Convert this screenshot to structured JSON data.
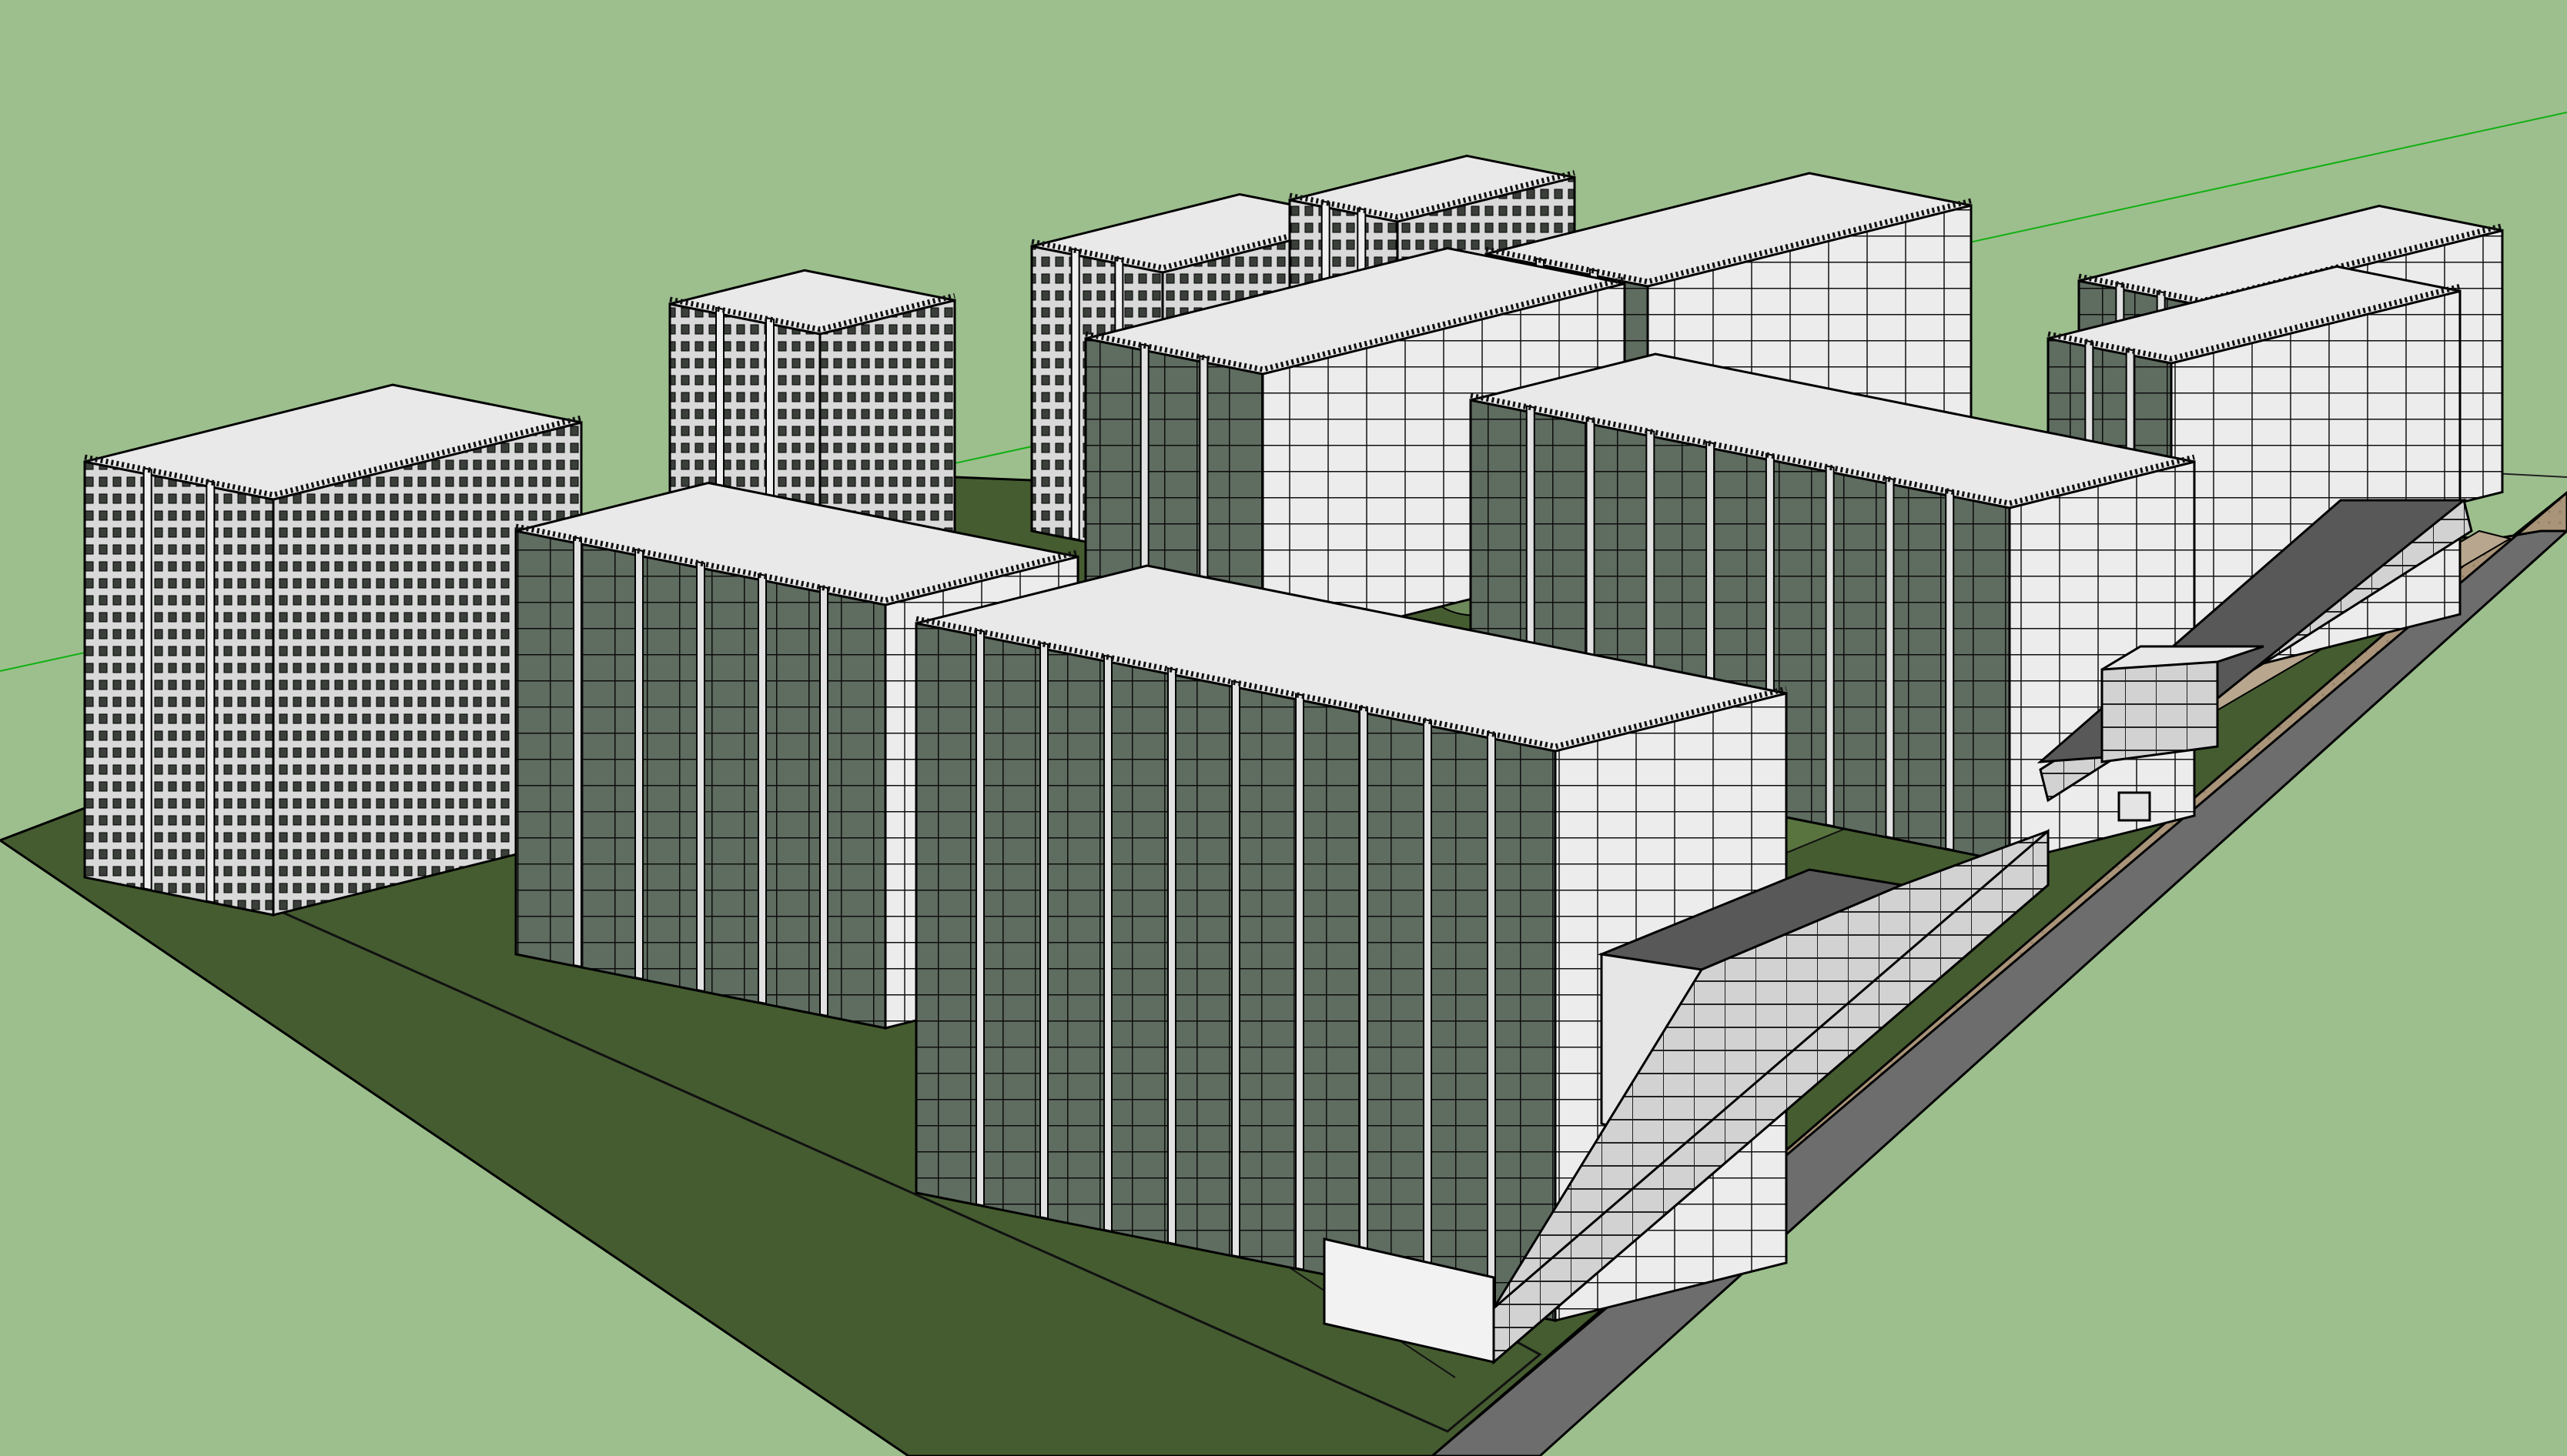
{
  "app": {
    "type": "3d-modeling-viewport",
    "view": "perspective"
  },
  "colors": {
    "sky_ground": "#9dbf8e",
    "site_lawn": "#455c30",
    "site_lawn_light": "#59743f",
    "paving": "#a8937a",
    "road": "#6e6e6e",
    "facade_glass": "#5e6b5e",
    "facade_white": "#e8e8e8",
    "roof_dark": "#5a5a5a",
    "edge": "#000000",
    "axis_red": "#d42020",
    "axis_green": "#10b010"
  },
  "scene": {
    "towers": [
      {
        "name": "tower-west-slim",
        "style": "window-grid"
      },
      {
        "name": "tower-north-1",
        "style": "window-grid"
      },
      {
        "name": "tower-north-2",
        "style": "window-grid"
      },
      {
        "name": "tower-north-3",
        "style": "window-grid"
      },
      {
        "name": "tower-west-glass",
        "style": "glass"
      },
      {
        "name": "tower-center-back",
        "style": "glass"
      },
      {
        "name": "tower-center-front",
        "style": "glass"
      },
      {
        "name": "tower-east-middle",
        "style": "glass"
      },
      {
        "name": "tower-east-back-1",
        "style": "glass"
      },
      {
        "name": "tower-east-back-2",
        "style": "glass"
      },
      {
        "name": "tower-east-corner",
        "style": "glass"
      }
    ],
    "podiums": [
      {
        "name": "retail-podium-south"
      },
      {
        "name": "retail-podium-east"
      },
      {
        "name": "pavilion-east"
      }
    ]
  }
}
